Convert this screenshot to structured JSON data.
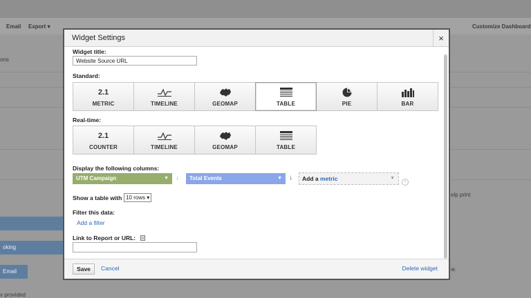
{
  "background": {
    "email": "Email",
    "export": "Export",
    "customize": "Customize Dashboard",
    "frag_ons": "ons",
    "frag_king": "oking",
    "frag_email": "Email",
    "frag_provided": "v provided",
    "frag_help": "elp print",
    "frag_w": "w."
  },
  "dialog": {
    "title": "Widget Settings",
    "close_glyph": "×",
    "widget_title_label": "Widget title:",
    "widget_title_value": "Website Source URL",
    "standard_label": "Standard:",
    "standard_tiles": [
      {
        "icon_text": "2.1",
        "label": "METRIC"
      },
      {
        "icon_text": "",
        "label": "TIMELINE"
      },
      {
        "icon_text": "",
        "label": "GEOMAP"
      },
      {
        "icon_text": "",
        "label": "TABLE"
      },
      {
        "icon_text": "",
        "label": "PIE"
      },
      {
        "icon_text": "",
        "label": "BAR"
      }
    ],
    "realtime_label": "Real-time:",
    "realtime_tiles": [
      {
        "icon_text": "2.1",
        "label": "COUNTER"
      },
      {
        "icon_text": "",
        "label": "TIMELINE"
      },
      {
        "icon_text": "",
        "label": "GEOMAP"
      },
      {
        "icon_text": "",
        "label": "TABLE"
      }
    ],
    "columns_label": "Display the following columns:",
    "dimension_select": "UTM Campaign",
    "metric_select": "Total Events",
    "add_a": "Add a",
    "metric_word": "metric",
    "show_table_label": "Show a table with",
    "rows_value": "10 rows",
    "filter_label": "Filter this data:",
    "add_filter": "Add a filter",
    "link_label": "Link to Report or URL:",
    "link_value": "",
    "save": "Save",
    "cancel": "Cancel",
    "delete": "Delete widget"
  },
  "colors": {
    "dimension": "#97ad6c",
    "metric": "#8aa6e8",
    "link": "#2c68b8"
  }
}
